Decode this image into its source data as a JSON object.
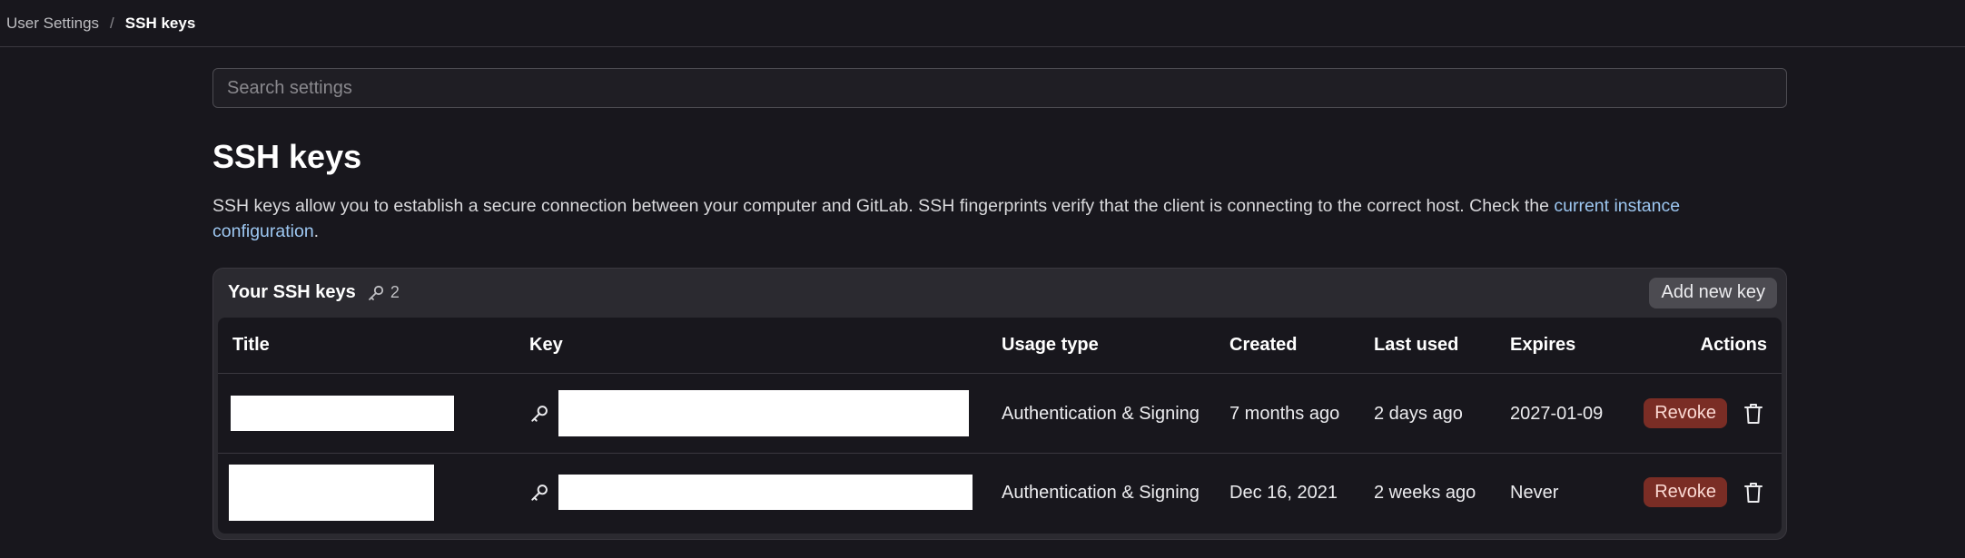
{
  "breadcrumb": {
    "parent": "User Settings",
    "separator": "/",
    "current": "SSH keys"
  },
  "search": {
    "placeholder": "Search settings"
  },
  "page": {
    "title": "SSH keys",
    "description": "SSH keys allow you to establish a secure connection between your computer and GitLab. SSH fingerprints verify that the client is connecting to the correct host. Check the ",
    "link_text": "current instance configuration",
    "description_end": "."
  },
  "card": {
    "title": "Your SSH keys",
    "count": "2",
    "add_label": "Add new key"
  },
  "table": {
    "headers": {
      "title": "Title",
      "key": "Key",
      "usage": "Usage type",
      "created": "Created",
      "last_used": "Last used",
      "expires": "Expires",
      "actions": "Actions"
    },
    "rows": [
      {
        "usage": "Authentication & Signing",
        "created": "7 months ago",
        "last_used": "2 days ago",
        "expires": "2027-01-09",
        "revoke": "Revoke"
      },
      {
        "usage": "Authentication & Signing",
        "created": "Dec 16, 2021",
        "last_used": "2 weeks ago",
        "expires": "Never",
        "revoke": "Revoke"
      }
    ]
  },
  "icons": {
    "key": "key-icon",
    "delete": "trash-icon"
  },
  "colors": {
    "background": "#18171d",
    "card": "#2b2a30",
    "link": "#9dc7f1",
    "revoke_bg": "#7a2d25",
    "revoke_text": "#fbd9d3"
  }
}
